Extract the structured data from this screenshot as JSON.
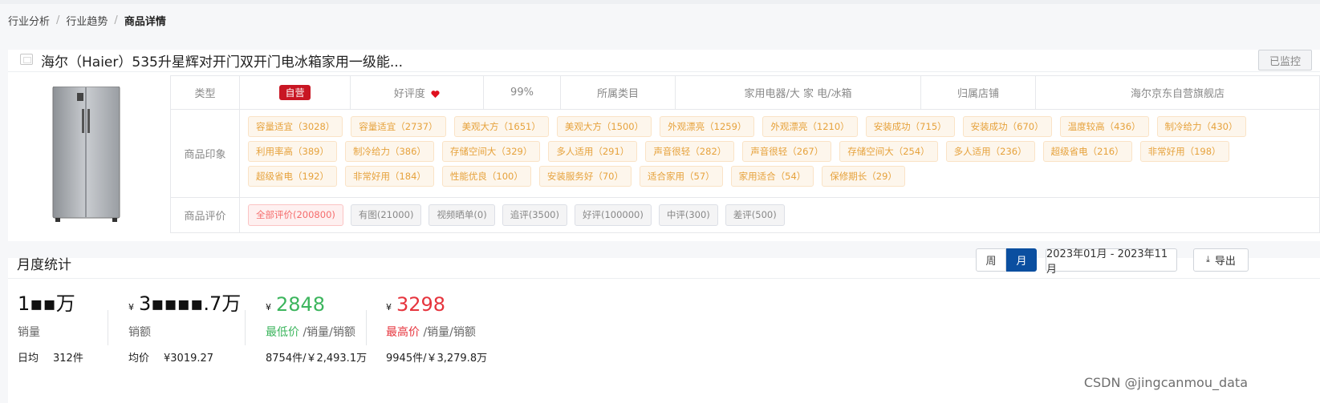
{
  "breadcrumb": [
    "行业分析",
    "行业趋势",
    "商品详情"
  ],
  "product": {
    "title": "海尔（Haier）535升星辉对开门双开门电冰箱家用一级能...",
    "monitor_label": "已监控",
    "info": {
      "type_label": "类型",
      "type_badge": "自营",
      "rating_label": "好评度",
      "rating_value": "99%",
      "category_label": "所属类目",
      "category_value": "家用电器/大 家 电/冰箱",
      "shop_label": "归属店铺",
      "shop_value": "海尔京东自营旗舰店"
    },
    "impression_label": "商品印象",
    "impressions": [
      "容量适宜（3028）",
      "容量适宜（2737）",
      "美观大方（1651）",
      "美观大方（1500）",
      "外观漂亮（1259）",
      "外观漂亮（1210）",
      "安装成功（715）",
      "安装成功（670）",
      "温度较高（436）",
      "制冷给力（430）",
      "利用率高（389）",
      "制冷给力（386）",
      "存储空间大（329）",
      "多人适用（291）",
      "声音很轻（282）",
      "声音很轻（267）",
      "存储空间大（254）",
      "多人适用（236）",
      "超级省电（216）",
      "非常好用（198）",
      "超级省电（192）",
      "非常好用（184）",
      "性能优良（100）",
      "安装服务好（70）",
      "适合家用（57）",
      "家用适合（54）",
      "保修期长（29）"
    ],
    "review_label": "商品评价",
    "reviews": [
      "全部评价(200800)",
      "有图(21000)",
      "视频晒单(0)",
      "追评(3500)",
      "好评(100000)",
      "中评(300)",
      "差评(500)"
    ],
    "colors": {
      "self_badge": "#c81623",
      "tag_text": "#e6a23c",
      "active_review": "#f56c6c"
    }
  },
  "stats": {
    "title": "月度统计",
    "periods": [
      "周",
      "月"
    ],
    "active_period": "月",
    "date_range": "2023年01月 - 2023年11月",
    "export_label": "导出",
    "volume": {
      "value": "1▪▪万",
      "label": "销量",
      "sub_label": "日均",
      "sub_value": "312件"
    },
    "sales": {
      "currency": "¥",
      "value": "3▪▪▪▪.7万",
      "label": "销额",
      "sub_label": "均价",
      "sub_value": "¥3019.27"
    },
    "min_price": {
      "currency": "¥",
      "value": "2848",
      "label_main": "最低价",
      "label_rest": " /销量/销额",
      "sub_value": "8754件/￥2,493.1万"
    },
    "max_price": {
      "currency": "¥",
      "value": "3298",
      "label_main": "最高价",
      "label_rest": " /销量/销额",
      "sub_value": "9945件/￥3,279.8万"
    }
  },
  "watermark": "CSDN @jingcanmou_data"
}
